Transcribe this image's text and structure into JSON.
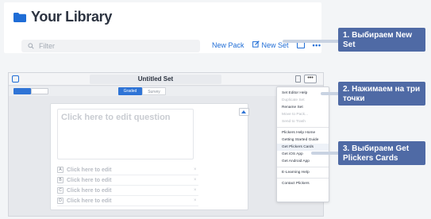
{
  "library": {
    "title": "Your Library",
    "filter_placeholder": "Filter",
    "new_pack_label": "New Pack",
    "new_set_label": "New Set",
    "more_label": "•••"
  },
  "editor": {
    "set_title": "Untitled Set",
    "more_label": "•••",
    "mode_graded": "Graded",
    "mode_survey": "Survey",
    "question_placeholder": "Click here to edit question",
    "answers": [
      {
        "letter": "A",
        "text": "Click here to edit"
      },
      {
        "letter": "B",
        "text": "Click here to edit"
      },
      {
        "letter": "C",
        "text": "Click here to edit"
      },
      {
        "letter": "D",
        "text": "Click here to edit"
      }
    ],
    "menu": {
      "group1": [
        "Set Editor Help",
        "Duplicate Set",
        "Rename Set",
        "Move to Pack...",
        "Send to Trash"
      ],
      "group1_disabled": [
        false,
        true,
        false,
        true,
        true
      ],
      "group2": [
        "Plickers Help Home",
        "Getting Started Guide",
        "Get Plickers Cards",
        "Get iOS App",
        "Get Android App"
      ],
      "group3": [
        "E-Learning Help"
      ],
      "group4": [
        "Contact Plickers"
      ]
    }
  },
  "callouts": {
    "step1": "1. Выбираем New Set",
    "step2": "2. Нажимаем на три точки",
    "step3": "3. Выбираем Get Plickers Cards"
  },
  "colors": {
    "accent": "#1f6dd6",
    "callout_bg": "#4f6aa5"
  }
}
